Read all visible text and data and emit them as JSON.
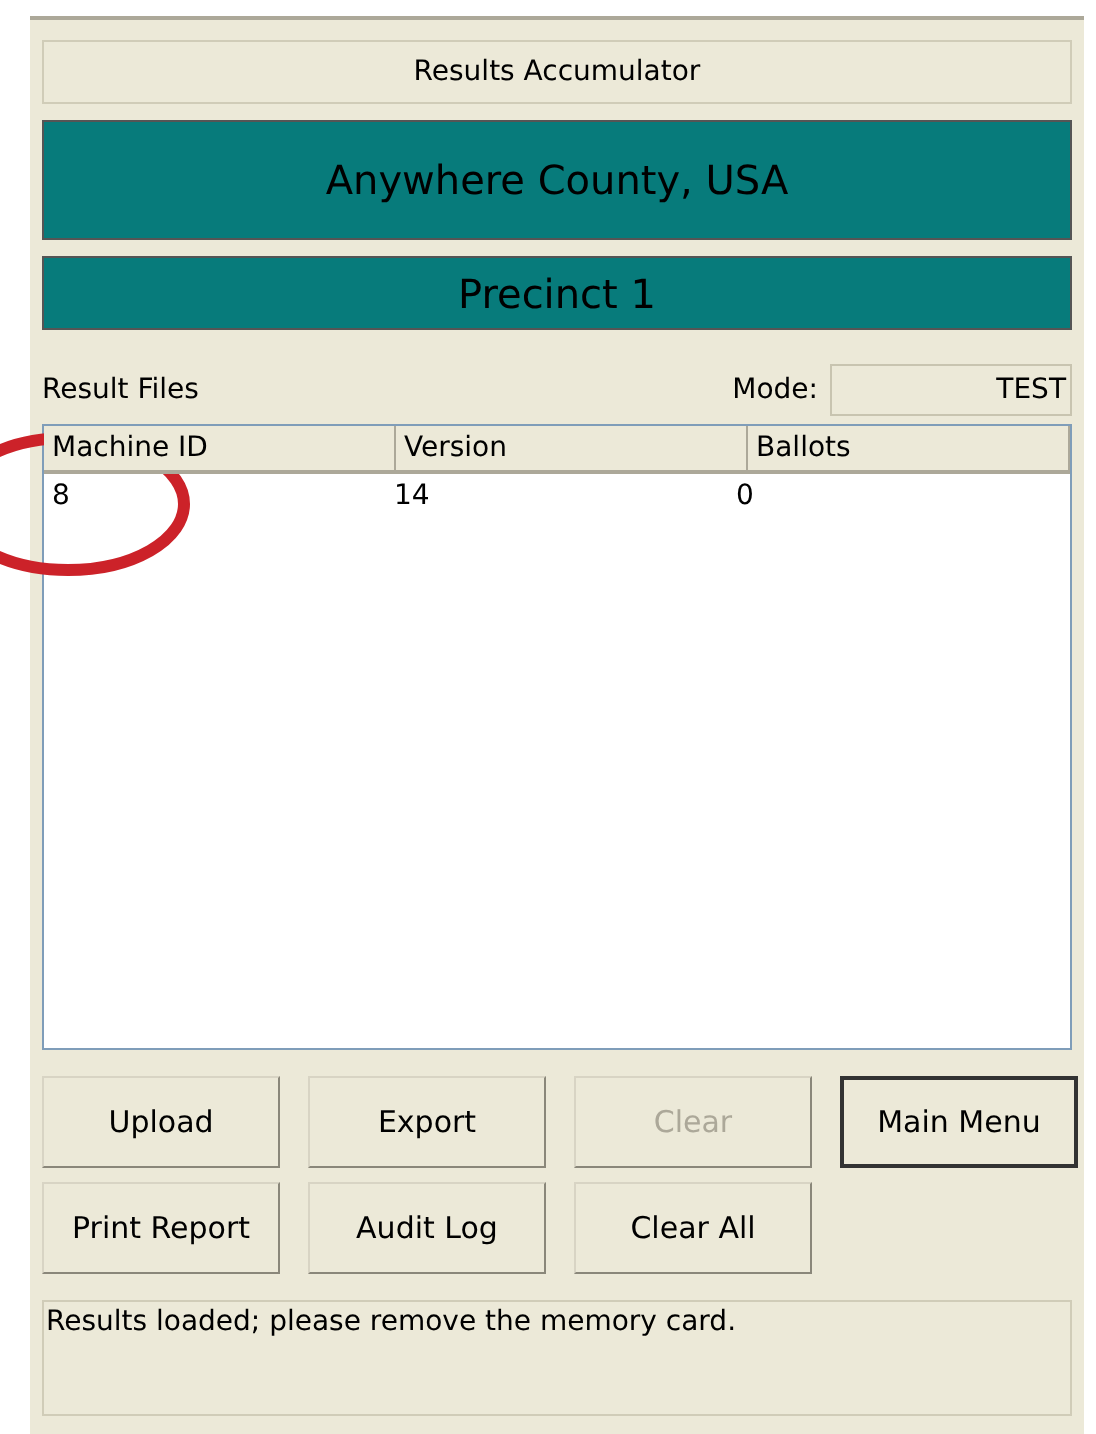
{
  "window": {
    "title": "Results Accumulator"
  },
  "county": "Anywhere County, USA",
  "precinct": "Precinct 1",
  "section_label": "Result Files",
  "mode": {
    "label": "Mode:",
    "value": "TEST"
  },
  "table": {
    "columns": [
      "Machine ID",
      "Version",
      "Ballots"
    ],
    "rows": [
      [
        "8",
        "14",
        "0"
      ]
    ]
  },
  "buttons": [
    {
      "label": "Upload",
      "disabled": false,
      "default": false
    },
    {
      "label": "Export",
      "disabled": false,
      "default": false
    },
    {
      "label": "Clear",
      "disabled": true,
      "default": false
    },
    {
      "label": "Main Menu",
      "disabled": false,
      "default": true
    },
    {
      "label": "Print Report",
      "disabled": false,
      "default": false
    },
    {
      "label": "Audit Log",
      "disabled": false,
      "default": false
    },
    {
      "label": "Clear All",
      "disabled": false,
      "default": false
    }
  ],
  "status": "Results loaded; please remove the memory card."
}
